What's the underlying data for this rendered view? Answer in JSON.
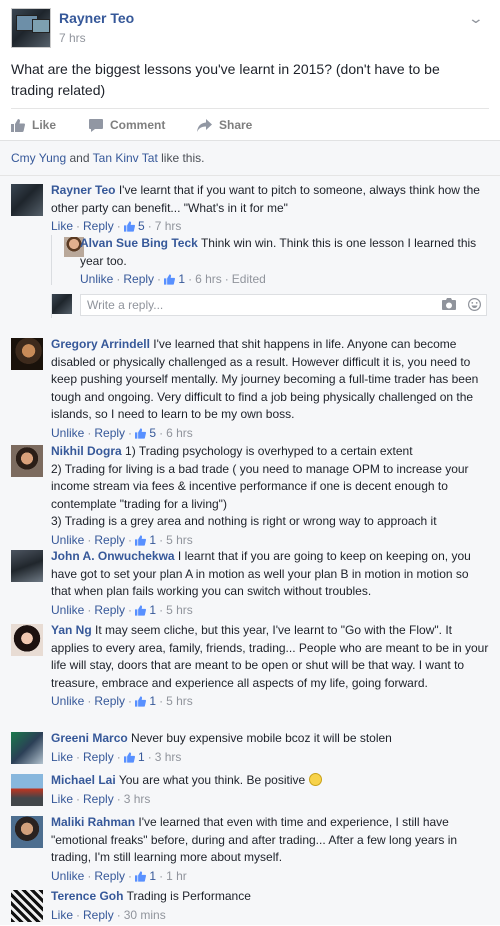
{
  "post": {
    "author": "Rayner Teo",
    "time": "7 hrs",
    "text": "What are the biggest lessons you've learnt in 2015? (don't have to be trading related)",
    "actions": {
      "like": "Like",
      "comment": "Comment",
      "share": "Share"
    }
  },
  "likes": {
    "user1": "Cmy Yung",
    "and": " and ",
    "user2": "Tan Kinv Tat",
    "suffix": " like this."
  },
  "comments": [
    {
      "name": "Rayner Teo",
      "text": "I've learnt that if you want to pitch to someone, always think how the other party can benefit... \"What's in it for me\"",
      "like": "Like",
      "reply": "Reply",
      "likes": "5",
      "time": "7 hrs",
      "replies": [
        {
          "name": "Alvan Sue Bing Teck",
          "text": "Think win win. Think this is one lesson I learned this year too.",
          "unlike": "Unlike",
          "reply": "Reply",
          "likes": "1",
          "time": "6 hrs",
          "edited": "Edited"
        }
      ],
      "write_reply_placeholder": "Write a reply..."
    },
    {
      "name": "Gregory Arrindell",
      "text": "I've learned that shit happens in life. Anyone can become disabled or physically challenged as a result. However difficult it is, you need to keep pushing yourself mentally. My journey becoming a full-time trader has been tough and ongoing. Very difficult to find a job being physically challenged on the islands, so I need to learn to be my own boss.",
      "like": "Unlike",
      "reply": "Reply",
      "likes": "5",
      "time": "6 hrs"
    },
    {
      "name": "Nikhil Dogra",
      "text_lines": [
        "1) Trading psychology is overhyped to a certain extent",
        "2) Trading for living is a bad trade ( you need to manage OPM to increase your income stream via fees & incentive performance if one is decent enough to contemplate \"trading for a living\")",
        "3) Trading is a grey area and nothing is right or wrong way to approach it"
      ],
      "like": "Unlike",
      "reply": "Reply",
      "likes": "1",
      "time": "5 hrs"
    },
    {
      "name": "John A. Onwuchekwa",
      "text": "I learnt that if you are going to keep on keeping on, you have got to set your plan A in motion as well your plan B in motion in motion so that when plan fails working you can switch without troubles.",
      "like": "Unlike",
      "reply": "Reply",
      "likes": "1",
      "time": "5 hrs"
    },
    {
      "name": "Yan Ng",
      "text": "It may seem cliche, but this year, I've learnt to \"Go with the Flow\". It applies to every area, family, friends, trading... People who are meant to be in your life will stay, doors that are meant to be open or shut will be that way. I want to treasure, embrace and experience all aspects of my life, going forward.",
      "like": "Unlike",
      "reply": "Reply",
      "likes": "1",
      "time": "5 hrs"
    },
    {
      "name": "Greeni Marco",
      "text": "Never buy expensive mobile bcoz it will be stolen",
      "like": "Like",
      "reply": "Reply",
      "likes": "1",
      "time": "3 hrs"
    },
    {
      "name": "Michael Lai",
      "text": "You are what you think. Be positive",
      "like": "Like",
      "reply": "Reply",
      "time": "3 hrs"
    },
    {
      "name": "Maliki Rahman",
      "text": "I've learned that even with time and experience, I still have \"emotional freaks\" before, during and after trading... After a few long years in trading, I'm still learning more about myself.",
      "like": "Unlike",
      "reply": "Reply",
      "likes": "1",
      "time": "1 hr"
    },
    {
      "name": "Terence Goh",
      "text": "Trading is Performance",
      "like": "Like",
      "reply": "Reply",
      "time": "30 mins"
    }
  ]
}
